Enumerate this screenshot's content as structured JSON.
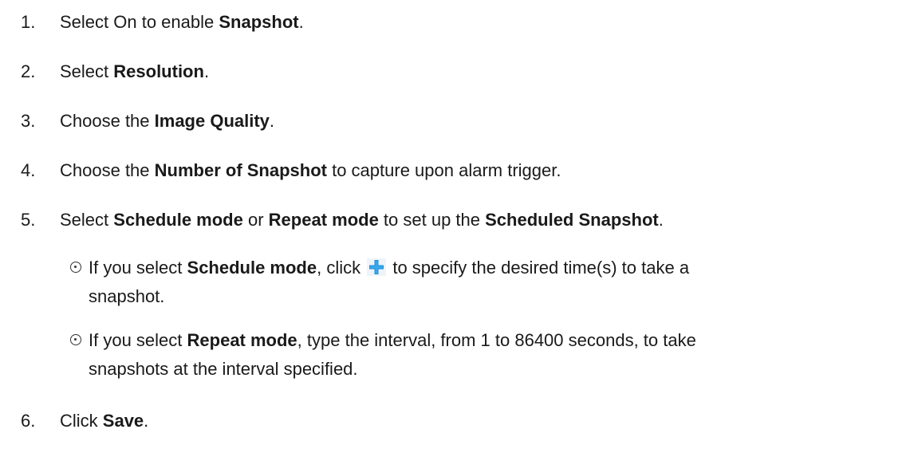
{
  "steps": [
    {
      "num": "1.",
      "p1": "Select On to enable ",
      "b1": "Snapshot",
      "p2": "."
    },
    {
      "num": "2.",
      "p1": "Select ",
      "b1": "Resolution",
      "p2": "."
    },
    {
      "num": "3.",
      "p1": "Choose the ",
      "b1": "Image Quality",
      "p2": "."
    },
    {
      "num": "4.",
      "p1": "Choose the ",
      "b1": "Number of Snapshot",
      "p2": " to capture upon alarm trigger."
    },
    {
      "num": "5.",
      "p1": "Select ",
      "b1": "Schedule mode",
      "p2": " or ",
      "b2": "Repeat mode",
      "p3": " to set up the ",
      "b3": "Scheduled Snapshot",
      "p4": "."
    },
    {
      "num": "6.",
      "p1": "Click ",
      "b1": "Save",
      "p2": "."
    }
  ],
  "bullets": [
    {
      "p1": "If you select ",
      "b1": "Schedule mode",
      "p2": ", click ",
      "icon": "plus-icon",
      "p3": " to specify the desired time(s) to take a",
      "line2": "snapshot."
    },
    {
      "p1": "If you select ",
      "b1": "Repeat mode",
      "p2": ", type the interval, from 1 to 86400 seconds, to take",
      "line2": "snapshots at the interval specified."
    }
  ],
  "colors": {
    "text": "#1a1a1a",
    "plus_icon": "#1e90d6"
  }
}
